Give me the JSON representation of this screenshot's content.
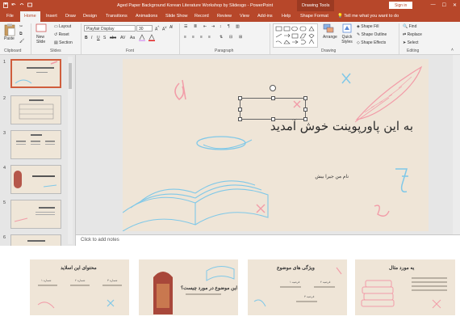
{
  "titlebar": {
    "doc_title": "Aged Paper Background Korean Literature Workshop by Slidesgo  -  PowerPoint",
    "tools_tab": "Drawing Tools",
    "sign_in": "Sign in",
    "min": "—",
    "max": "☐",
    "close": "✕"
  },
  "tabs": {
    "items": [
      "File",
      "Home",
      "Insert",
      "Draw",
      "Design",
      "Transitions",
      "Animations",
      "Slide Show",
      "Record",
      "Review",
      "View",
      "Add-ins",
      "Help",
      "Shape Format"
    ],
    "active": "Home",
    "tell_me": "Tell me what you want to do"
  },
  "ribbon": {
    "paste": "Paste",
    "new_slide": "New Slide",
    "layout": "Layout",
    "reset": "Reset",
    "section": "Section",
    "font_name": "Playfair Display",
    "font_size": "30",
    "arrange": "Arrange",
    "quick_styles": "Quick Styles",
    "shape_fill": "Shape Fill",
    "shape_outline": "Shape Outline",
    "shape_effects": "Shape Effects",
    "find": "Find",
    "replace": "Replace",
    "select": "Select",
    "groups": {
      "clipboard": "Clipboard",
      "slides": "Slides",
      "font": "Font",
      "paragraph": "Paragraph",
      "drawing": "Drawing",
      "editing": "Editing"
    }
  },
  "thumbnails": {
    "numbers": [
      "1",
      "2",
      "3",
      "4",
      "5",
      "6"
    ]
  },
  "slide": {
    "title": "به این پاورپوینت خوش آمدید",
    "subtitle": "نام من جیرا بیش"
  },
  "notes": {
    "placeholder": "Click to add notes"
  },
  "previews": [
    {
      "title": "محتوای این اسلاید",
      "items": [
        "شماره ۱",
        "شماره ۲",
        "شماره ۳"
      ]
    },
    {
      "title": "این موضوع در مورد چیست؟"
    },
    {
      "title": "ویژگی های موضوع",
      "items": [
        "فرضیه ۱",
        "فرضیه ۲",
        "فرضیه ۳"
      ]
    },
    {
      "title": "یه مورد مثال"
    }
  ],
  "colors": {
    "accent": "#b7472a",
    "paper": "#efe5d7",
    "pink": "#f29ca8",
    "blue": "#7fc8e8"
  }
}
